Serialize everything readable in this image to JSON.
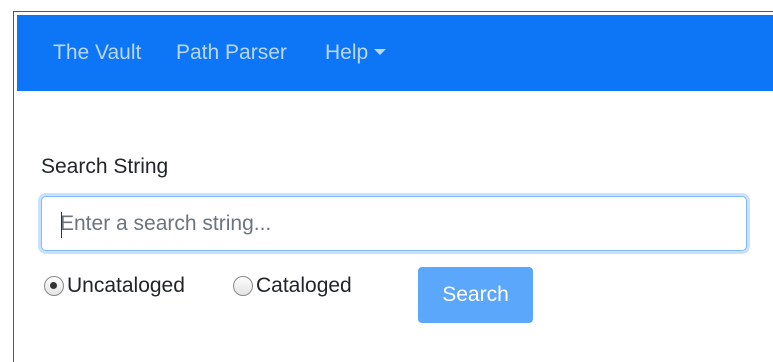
{
  "navbar": {
    "items": [
      {
        "label": "The Vault"
      },
      {
        "label": "Path Parser"
      },
      {
        "label": "Help"
      }
    ]
  },
  "search": {
    "label": "Search String",
    "value": "",
    "placeholder": "Enter a search string...",
    "options": [
      {
        "label": "Uncataloged",
        "selected": true
      },
      {
        "label": "Cataloged",
        "selected": false
      }
    ],
    "button_label": "Search"
  },
  "colors": {
    "navbar_bg": "#0d76f6",
    "nav_link": "#b9d6fb",
    "button_bg": "#5ba7fb",
    "input_focus_border": "#80bdff"
  },
  "icons": {
    "help_dropdown": "caret-down-icon"
  }
}
